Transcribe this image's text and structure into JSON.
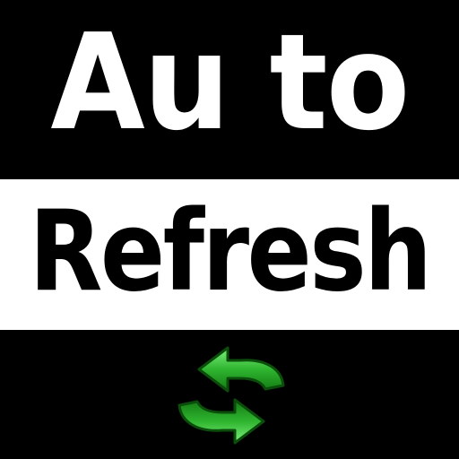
{
  "title": {
    "line1": "Au to",
    "line2": "Refresh"
  },
  "icon": "refresh-arrows-icon",
  "colors": {
    "background": "#000000",
    "band": "#ffffff",
    "icon_green": "#2fb52f"
  }
}
